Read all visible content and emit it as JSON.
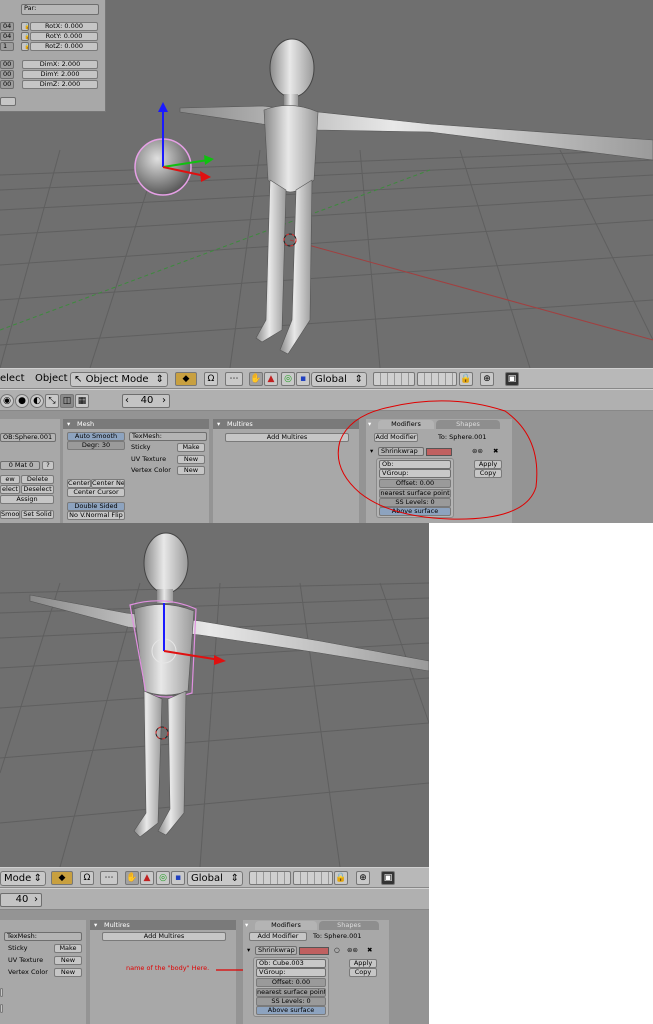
{
  "top_panel": {
    "par_label": "Par:",
    "rows": [
      {
        "left": "04",
        "label": "RotX: 0.000"
      },
      {
        "left": "04",
        "label": "RotY: 0.000"
      },
      {
        "left": "1",
        "label": "RotZ: 0.000"
      },
      {
        "left": "00",
        "label": "DimX: 2.000"
      },
      {
        "left": "00",
        "label": "DimY: 2.000"
      },
      {
        "left": "00",
        "label": "DimZ: 2.000"
      }
    ]
  },
  "header1": {
    "select_menu": "elect",
    "object_menu": "Object",
    "mode": "Object Mode",
    "orientation": "Global"
  },
  "buttons_header": {
    "frame": "40"
  },
  "link_panel": {
    "ob": "OB:Sphere.001",
    "mat_field": "0 Mat 0",
    "question": "?",
    "new": "ew",
    "delete": "Delete",
    "select": "elect",
    "deselect": "Deselect",
    "assign": "Assign",
    "smooth": "Smoot",
    "set_solid": "Set Solid"
  },
  "mesh_panel": {
    "title": "Mesh",
    "auto_smooth": "Auto Smooth",
    "degr": "Degr: 30",
    "texmesh": "TexMesh:",
    "sticky": "Sticky",
    "uv_texture": "UV Texture",
    "vertex_color": "Vertex Color",
    "make": "Make",
    "new": "New",
    "center": "Center",
    "center_new": "Center New",
    "center_cursor": "Center Cursor",
    "double_sided": "Double Sided",
    "no_vnormal_flip": "No V.Normal Flip"
  },
  "multires_panel": {
    "title": "Multires",
    "add": "Add Multires"
  },
  "modifiers_panel": {
    "tab_modifiers": "Modifiers",
    "tab_shapes": "Shapes",
    "add_modifier": "Add Modifier",
    "to": "To: Sphere.001",
    "name": "Shrinkwrap",
    "ob": "Ob:",
    "vgroup": "VGroup:",
    "offset": "Offset: 0.00",
    "nearest": "nearest surface point",
    "ss_levels": "SS Levels: 0",
    "above": "Above surface",
    "apply": "Apply",
    "copy": "Copy"
  },
  "header2": {
    "mode": "Mode",
    "orientation": "Global"
  },
  "buttons_header2": {
    "frame": "40"
  },
  "bottom_texmesh": {
    "texmesh": "TexMesh:",
    "sticky": "Sticky",
    "uv_texture": "UV Texture",
    "vertex_color": "Vertex Color",
    "make": "Make",
    "new": "New"
  },
  "multires_panel2": {
    "title": "Multires",
    "add": "Add Multires"
  },
  "modifiers_panel2": {
    "tab_modifiers": "Modifiers",
    "tab_shapes": "Shapes",
    "add_modifier": "Add Modifier",
    "to": "To: Sphere.001",
    "name": "Shrinkwrap",
    "ob": "Ob: Cube.003",
    "vgroup": "VGroup:",
    "offset": "Offset: 0.00",
    "nearest": "nearest surface point",
    "ss_levels": "SS Levels: 0",
    "above": "Above surface",
    "apply": "Apply",
    "copy": "Copy"
  },
  "annotation": "name of the \"body\" Here.",
  "colors": {
    "viewport": "#6f6f6f",
    "annotation_red": "#e00000",
    "axis_z": "#1a1aff",
    "axis_x": "#e01010",
    "axis_y": "#10c010"
  }
}
